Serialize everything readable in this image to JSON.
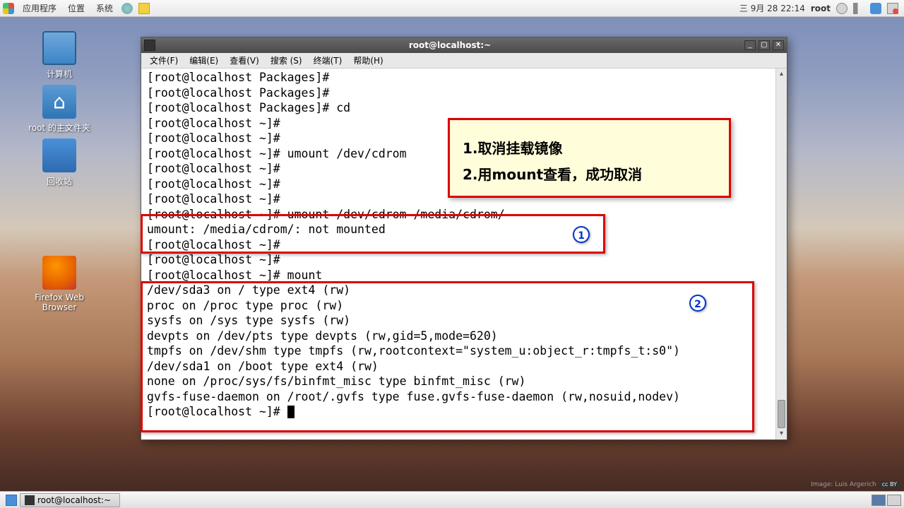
{
  "top_panel": {
    "apps": "应用程序",
    "places": "位置",
    "system": "系统",
    "clock": "三 9月 28 22:14",
    "user": "root"
  },
  "desktop": {
    "computer": "计算机",
    "home": "root 的主文件夹",
    "trash": "回收站",
    "firefox": "Firefox Web Browser"
  },
  "terminal": {
    "title": "root@localhost:~",
    "menu": {
      "file": "文件(F)",
      "edit": "编辑(E)",
      "view": "查看(V)",
      "search": "搜索 (S)",
      "terminal": "终端(T)",
      "help": "帮助(H)"
    },
    "lines": [
      "[root@localhost Packages]#",
      "[root@localhost Packages]#",
      "[root@localhost Packages]# cd",
      "[root@localhost ~]#",
      "[root@localhost ~]#",
      "[root@localhost ~]# umount /dev/cdrom",
      "[root@localhost ~]#",
      "[root@localhost ~]#",
      "[root@localhost ~]#",
      "[root@localhost ~]# umount /dev/cdrom /media/cdrom/",
      "umount: /media/cdrom/: not mounted",
      "[root@localhost ~]#",
      "[root@localhost ~]#",
      "[root@localhost ~]# mount",
      "/dev/sda3 on / type ext4 (rw)",
      "proc on /proc type proc (rw)",
      "sysfs on /sys type sysfs (rw)",
      "devpts on /dev/pts type devpts (rw,gid=5,mode=620)",
      "tmpfs on /dev/shm type tmpfs (rw,rootcontext=\"system_u:object_r:tmpfs_t:s0\")",
      "/dev/sda1 on /boot type ext4 (rw)",
      "none on /proc/sys/fs/binfmt_misc type binfmt_misc (rw)",
      "gvfs-fuse-daemon on /root/.gvfs type fuse.gvfs-fuse-daemon (rw,nosuid,nodev)",
      "[root@localhost ~]# "
    ]
  },
  "annotation": {
    "line1": "1.取消挂载镜像",
    "line2": "2.用mount查看，成功取消",
    "num1": "1",
    "num2": "2"
  },
  "bottom_panel": {
    "task": "root@localhost:~"
  },
  "attribution": "Image: Luis Argerich"
}
